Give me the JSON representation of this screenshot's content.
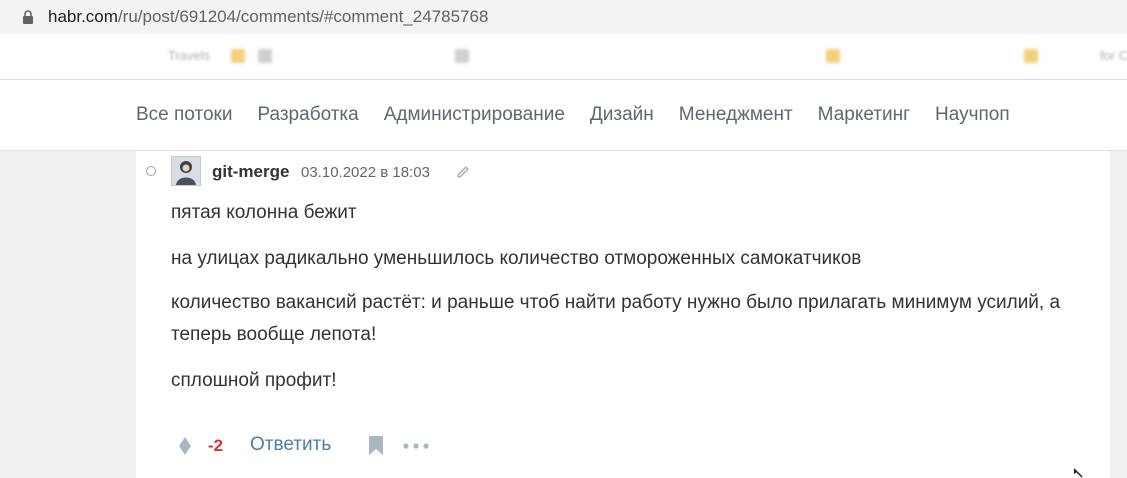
{
  "browser": {
    "url_host": "habr.com",
    "url_path": "/ru/post/691204/comments/#comment_24785768"
  },
  "bookmarks": {
    "items": [
      "Travels",
      "",
      "",
      "",
      "",
      "",
      "",
      "",
      "for C"
    ]
  },
  "site_nav": {
    "items": [
      "Все потоки",
      "Разработка",
      "Администрирование",
      "Дизайн",
      "Менеджмент",
      "Маркетинг",
      "Научпоп"
    ]
  },
  "comment": {
    "author": "git-merge",
    "date": "03.10.2022 в 18:03",
    "paragraphs": [
      "пятая колонна бежит",
      "на улицах радикально уменьшилось количество отмороженных самокатчиков",
      "количество вакансий растёт: и раньше чтоб найти работу нужно было прилагать минимум усилий, а теперь вообще лепота!",
      "сплошной профит!"
    ],
    "score": "-2",
    "reply_label": "Ответить"
  },
  "colors": {
    "score_negative": "#d0353b",
    "link": "#4b7ea6",
    "nav_text": "#5e6870"
  }
}
